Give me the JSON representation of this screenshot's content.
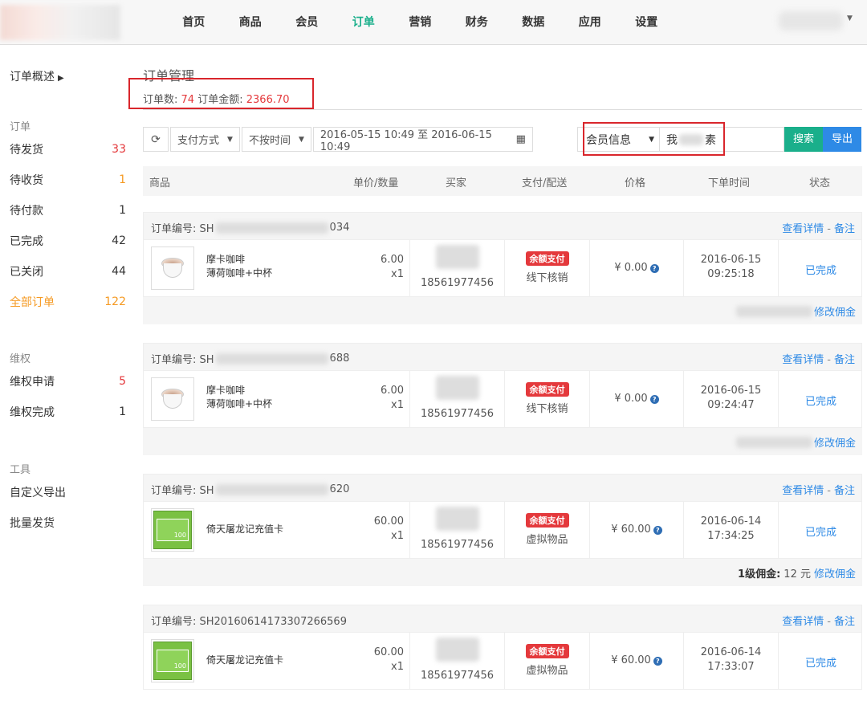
{
  "nav": {
    "items": [
      "首页",
      "商品",
      "会员",
      "订单",
      "营销",
      "财务",
      "数据",
      "应用",
      "设置"
    ],
    "active": "订单"
  },
  "sidebar": {
    "overview": "订单概述",
    "groups": [
      {
        "title": "订单",
        "items": [
          {
            "label": "待发货",
            "count": "33",
            "color": "red"
          },
          {
            "label": "待收货",
            "count": "1",
            "color": "orange"
          },
          {
            "label": "待付款",
            "count": "1",
            "color": ""
          },
          {
            "label": "已完成",
            "count": "42",
            "color": ""
          },
          {
            "label": "已关闭",
            "count": "44",
            "color": ""
          },
          {
            "label": "全部订单",
            "count": "122",
            "color": "active"
          }
        ]
      },
      {
        "title": "维权",
        "items": [
          {
            "label": "维权申请",
            "count": "5",
            "color": "red"
          },
          {
            "label": "维权完成",
            "count": "1",
            "color": ""
          }
        ]
      },
      {
        "title": "工具",
        "items": [
          {
            "label": "自定义导出",
            "count": "",
            "color": ""
          },
          {
            "label": "批量发货",
            "count": "",
            "color": ""
          }
        ]
      }
    ]
  },
  "main": {
    "title": "订单管理",
    "stats_count_label": "订单数:",
    "stats_count": "74",
    "stats_amount_label": "订单金额:",
    "stats_amount": "2366.70"
  },
  "filter": {
    "pay_method": "支付方式",
    "time_mode": "不按时间",
    "date_range": "2016-05-15 10:49 至 2016-06-15 10:49",
    "member_field": "会员信息",
    "member_value_prefix": "我",
    "member_value_suffix": "素",
    "search_label": "搜索",
    "export_label": "导出"
  },
  "table_headers": [
    "商品",
    "单价/数量",
    "买家",
    "支付/配送",
    "价格",
    "下单时间",
    "状态"
  ],
  "orders": [
    {
      "no_prefix": "订单编号: SH",
      "no_suffix": "034",
      "view": "查看详情",
      "note": "备注",
      "product": "摩卡咖啡",
      "spec": "薄荷咖啡+中杯",
      "img": "coffee",
      "unit_price": "6.00",
      "qty": "x1",
      "buyer_phone": "18561977456",
      "pay_badge": "余额支付",
      "delivery": "线下核销",
      "amount": "¥ 0.00",
      "date": "2016-06-15",
      "time": "09:25:18",
      "status": "已完成",
      "footer_label": "",
      "footer_value": "",
      "footer_link": "修改佣金",
      "footer_blur": true
    },
    {
      "no_prefix": "订单编号: SH",
      "no_suffix": "688",
      "view": "查看详情",
      "note": "备注",
      "product": "摩卡咖啡",
      "spec": "薄荷咖啡+中杯",
      "img": "coffee",
      "unit_price": "6.00",
      "qty": "x1",
      "buyer_phone": "18561977456",
      "pay_badge": "余额支付",
      "delivery": "线下核销",
      "amount": "¥ 0.00",
      "date": "2016-06-15",
      "time": "09:24:47",
      "status": "已完成",
      "footer_label": "",
      "footer_value": "",
      "footer_link": "修改佣金",
      "footer_blur": true
    },
    {
      "no_prefix": "订单编号: SH",
      "no_suffix": "620",
      "view": "查看详情",
      "note": "备注",
      "product": "倚天屠龙记充值卡",
      "spec": "",
      "img": "card",
      "unit_price": "60.00",
      "qty": "x1",
      "buyer_phone": "18561977456",
      "pay_badge": "余额支付",
      "delivery": "虚拟物品",
      "amount": "¥ 60.00",
      "date": "2016-06-14",
      "time": "17:34:25",
      "status": "已完成",
      "footer_label": "1级佣金:",
      "footer_value": "12 元",
      "footer_link": "修改佣金",
      "footer_blur": false
    },
    {
      "no_prefix": "订单编号: SH20160614173307266569",
      "no_suffix": "",
      "view": "查看详情",
      "note": "备注",
      "product": "倚天屠龙记充值卡",
      "spec": "",
      "img": "card",
      "unit_price": "60.00",
      "qty": "x1",
      "buyer_phone": "18561977456",
      "pay_badge": "余额支付",
      "delivery": "虚拟物品",
      "amount": "¥ 60.00",
      "date": "2016-06-14",
      "time": "17:33:07",
      "status": "已完成",
      "footer_label": "",
      "footer_value": "",
      "footer_link": "",
      "footer_blur": false
    }
  ],
  "card_text": "100"
}
